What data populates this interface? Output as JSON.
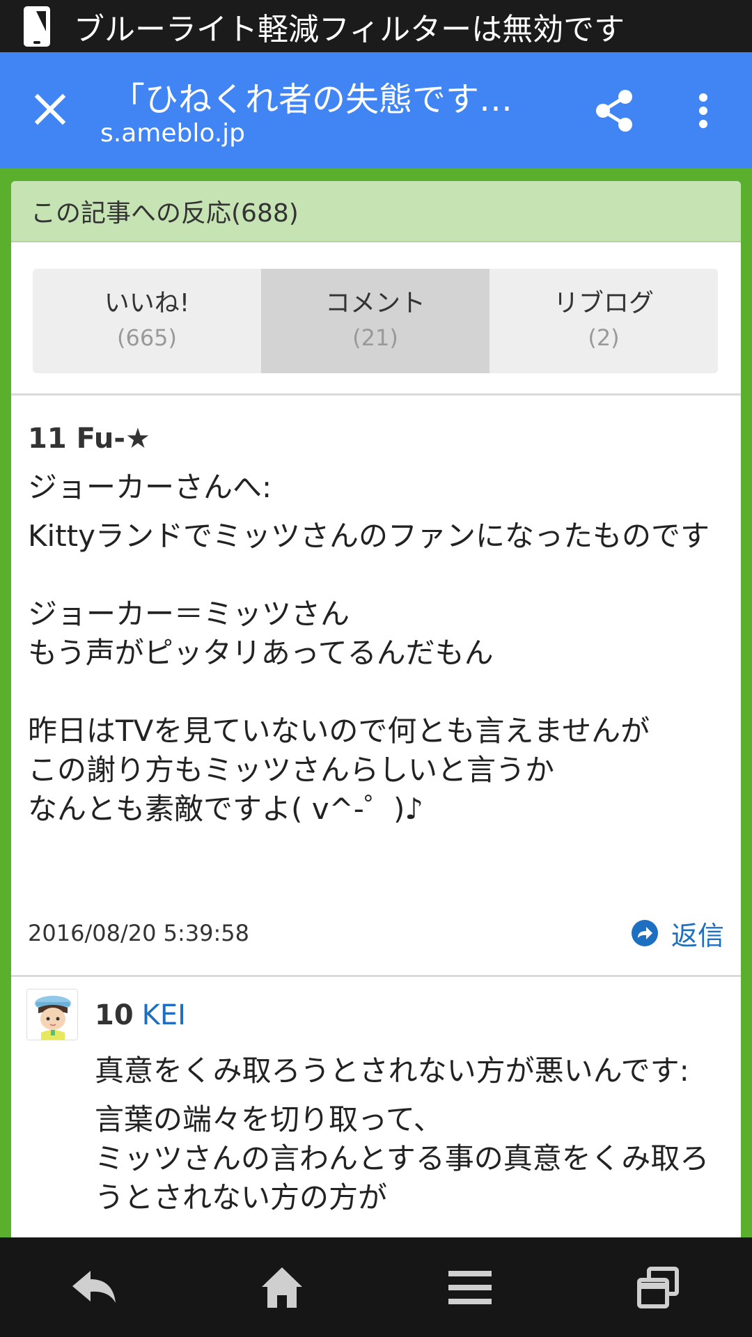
{
  "status_bar": {
    "text": "ブルーライト軽減フィルターは無効です",
    "icon": "phone-icon"
  },
  "app_bar": {
    "title": "「ひねくれ者の失態です…",
    "domain": "s.ameblo.jp",
    "accent": "#4185f4"
  },
  "card": {
    "header": "この記事への反応(688)"
  },
  "tabs": [
    {
      "label": "いいね!",
      "count": "(665)"
    },
    {
      "label": "コメント",
      "count": "(21)",
      "active": true
    },
    {
      "label": "リブログ",
      "count": "(2)"
    }
  ],
  "comment1": {
    "header": "11 Fu-★",
    "subject": "ジョーカーさんへ:",
    "body": "Kittyランドでミッツさんのファンになったものです\n\nジョーカー＝ミッツさん\nもう声がピッタリあってるんだもん\n\n昨日はTVを見ていないので何とも言えませんが\nこの謝り方もミッツさんらしいと言うか\nなんとも素敵ですよ( v^-゜)♪",
    "date": "2016/08/20 5:39:58",
    "reply_label": "返信"
  },
  "comment2": {
    "number": "10",
    "user": "KEI",
    "subject": "真意をくみ取ろうとされない方が悪いんです:",
    "body": "言葉の端々を切り取って、\nミッツさんの言わんとする事の真意をくみ取ろうとされない方の方が"
  },
  "colors": {
    "frame_green": "#5aaf2c",
    "header_green": "#c6e3b4",
    "link_blue": "#1d6fc2"
  }
}
